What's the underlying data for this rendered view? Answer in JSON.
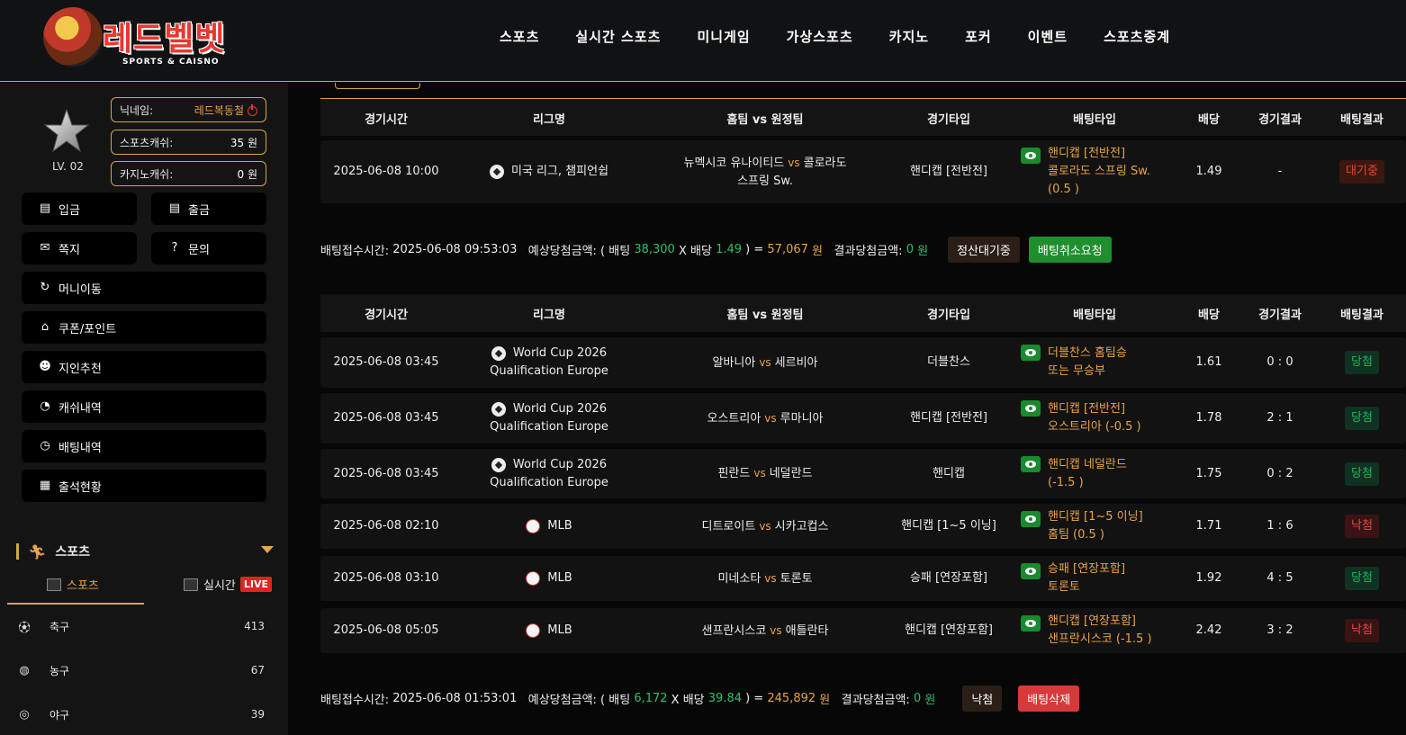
{
  "logo": {
    "text": "레드벨벳",
    "sub": "SPORTS & CAISNO"
  },
  "nav": [
    "스포츠",
    "실시간 스포츠",
    "미니게임",
    "가상스포츠",
    "카지노",
    "포커",
    "이벤트",
    "스포츠중계"
  ],
  "user": {
    "level": "LV. 02",
    "nickname_label": "닉네임:",
    "nickname": "레드복동철",
    "sports_cash_label": "스포츠캐쉬:",
    "sports_cash": "35 원",
    "casino_cash_label": "카지노캐쉬:",
    "casino_cash": "0 원"
  },
  "menu": {
    "deposit": "입금",
    "withdraw": "출금",
    "message": "쪽지",
    "inquiry": "문의",
    "money_move": "머니이동",
    "coupon": "쿠폰/포인트",
    "referral": "지인추천",
    "cash_history": "캐쉬내역",
    "bet_history": "배팅내역",
    "attendance": "출석현황"
  },
  "sports_section": {
    "title": "스포츠",
    "tab_sports": "스포츠",
    "tab_live": "실시간",
    "live_badge": "LIVE",
    "items": [
      {
        "name": "축구",
        "count": "413",
        "icon": "soccer-ball-icon"
      },
      {
        "name": "농구",
        "count": "67",
        "icon": "basketball-icon"
      },
      {
        "name": "야구",
        "count": "39",
        "icon": "baseball-icon"
      }
    ]
  },
  "table_headers": [
    "경기시간",
    "리그명",
    "홈팀 vs 원정팀",
    "경기타입",
    "배팅타입",
    "배당",
    "경기결과",
    "배팅결과"
  ],
  "vs": "vs",
  "bet1": {
    "rows": [
      {
        "time": "2025-06-08 10:00",
        "league1": "미국 리그, 챔피언쉽",
        "league2": "",
        "home": "뉴멕시코 유나이티드",
        "away": "콜로라도 스프링 Sw.",
        "type": "핸디캡 [전반전]",
        "bet_line1": "핸디캡 [전반전]",
        "bet_line2": "콜로라도 스프링 Sw.",
        "bet_line3": "(0.5 )",
        "odds": "1.49",
        "score": "-",
        "result": "대기중"
      }
    ],
    "summary": {
      "time_label": "배팅접수시간:",
      "time": "2025-06-08 09:53:03",
      "expected_label": "예상당첨금액: ( 배팅",
      "stake": "38,300",
      "x_label": "X 배당",
      "odds": "1.49",
      "eq": ") =",
      "expected": "57,067",
      "won": "원",
      "result_label": "결과당첨금액:",
      "result_amount": "0",
      "won2": "원",
      "status_btn": "정산대기중",
      "action_btn": "배팅취소요청"
    }
  },
  "bet2": {
    "rows": [
      {
        "time": "2025-06-08 03:45",
        "league1": "World Cup 2026",
        "league2": "Qualification Europe",
        "home": "알바니아",
        "away": "세르비아",
        "type": "더블찬스",
        "bet_line1": "더블찬스 홈팀승",
        "bet_line2": "또는 무승부",
        "bet_line3": "",
        "odds": "1.61",
        "score": "0 : 0",
        "result": "당첨"
      },
      {
        "time": "2025-06-08 03:45",
        "league1": "World Cup 2026",
        "league2": "Qualification Europe",
        "home": "오스트리아",
        "away": "루마니아",
        "type": "핸디캡 [전반전]",
        "bet_line1": "핸디캡 [전반전]",
        "bet_line2": "오스트리아 (-0.5 )",
        "bet_line3": "",
        "odds": "1.78",
        "score": "2 : 1",
        "result": "당첨"
      },
      {
        "time": "2025-06-08 03:45",
        "league1": "World Cup 2026",
        "league2": "Qualification Europe",
        "home": "핀란드",
        "away": "네덜란드",
        "type": "핸디캡",
        "bet_line1": "핸디캡 네덜란드",
        "bet_line2": "(-1.5 )",
        "bet_line3": "",
        "odds": "1.75",
        "score": "0 : 2",
        "result": "당첨"
      },
      {
        "time": "2025-06-08 02:10",
        "league1": "MLB",
        "league2": "",
        "home": "디트로이트",
        "away": "시카고컵스",
        "type": "핸디캡 [1~5 이닝]",
        "bet_line1": "핸디캡 [1~5 이닝]",
        "bet_line2": "홈팀 (0.5 )",
        "bet_line3": "",
        "odds": "1.71",
        "score": "1 : 6",
        "result": "낙첨"
      },
      {
        "time": "2025-06-08 03:10",
        "league1": "MLB",
        "league2": "",
        "home": "미네소타",
        "away": "토론토",
        "type": "승패 [연장포함]",
        "bet_line1": "승패 [연장포함]",
        "bet_line2": "토론토",
        "bet_line3": "",
        "odds": "1.92",
        "score": "4 : 5",
        "result": "당첨"
      },
      {
        "time": "2025-06-08 05:05",
        "league1": "MLB",
        "league2": "",
        "home": "샌프란시스코",
        "away": "애틀란타",
        "type": "핸디캡 [연장포함]",
        "bet_line1": "핸디캡 [연장포함]",
        "bet_line2": "샌프란시스코 (-1.5 )",
        "bet_line3": "",
        "odds": "2.42",
        "score": "3 : 2",
        "result": "낙첨"
      }
    ],
    "summary": {
      "time_label": "배팅접수시간:",
      "time": "2025-06-08 01:53:01",
      "expected_label": "예상당첨금액: ( 배팅",
      "stake": "6,172",
      "x_label": "X 배당",
      "odds": "39.84",
      "eq": ") =",
      "expected": "245,892",
      "won": "원",
      "result_label": "결과당첨금액:",
      "result_amount": "0",
      "won2": "원",
      "status_btn": "낙첨",
      "action_btn": "배팅삭제"
    }
  },
  "colors": {
    "accent": "#d4a93b",
    "green": "#1f8f2e",
    "red": "#d63a3a",
    "win": "#22b45a",
    "lose": "#e04848"
  }
}
